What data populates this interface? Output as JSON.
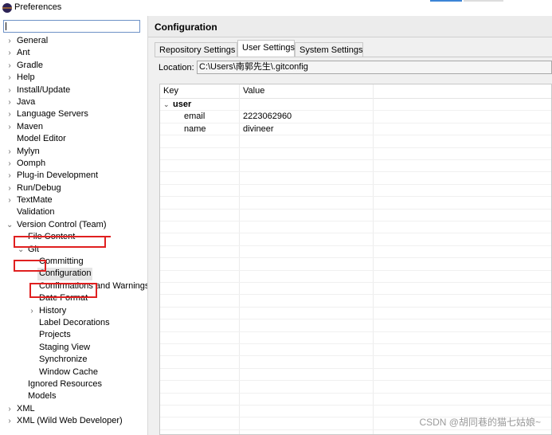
{
  "window": {
    "title": "Preferences"
  },
  "filter": {
    "value": ""
  },
  "tree": {
    "items": [
      {
        "label": "General",
        "expandable": true
      },
      {
        "label": "Ant",
        "expandable": true
      },
      {
        "label": "Gradle",
        "expandable": true
      },
      {
        "label": "Help",
        "expandable": true
      },
      {
        "label": "Install/Update",
        "expandable": true
      },
      {
        "label": "Java",
        "expandable": true
      },
      {
        "label": "Language Servers",
        "expandable": true
      },
      {
        "label": "Maven",
        "expandable": true
      },
      {
        "label": "Model Editor",
        "expandable": false
      },
      {
        "label": "Mylyn",
        "expandable": true
      },
      {
        "label": "Oomph",
        "expandable": true
      },
      {
        "label": "Plug-in Development",
        "expandable": true
      },
      {
        "label": "Run/Debug",
        "expandable": true
      },
      {
        "label": "TextMate",
        "expandable": true
      },
      {
        "label": "Validation",
        "expandable": false
      },
      {
        "label": "Version Control (Team)",
        "expandable": true,
        "expanded": true
      },
      {
        "label": "File Content",
        "expandable": false
      },
      {
        "label": "Git",
        "expandable": true,
        "expanded": true
      },
      {
        "label": "Committing",
        "expandable": false
      },
      {
        "label": "Configuration",
        "expandable": false,
        "selected": true
      },
      {
        "label": "Confirmations and Warnings",
        "expandable": false
      },
      {
        "label": "Date Format",
        "expandable": false
      },
      {
        "label": "History",
        "expandable": true
      },
      {
        "label": "Label Decorations",
        "expandable": false
      },
      {
        "label": "Projects",
        "expandable": false
      },
      {
        "label": "Staging View",
        "expandable": false
      },
      {
        "label": "Synchronize",
        "expandable": false
      },
      {
        "label": "Window Cache",
        "expandable": false
      },
      {
        "label": "Ignored Resources",
        "expandable": false
      },
      {
        "label": "Models",
        "expandable": false
      },
      {
        "label": "XML",
        "expandable": true
      },
      {
        "label": "XML (Wild Web Developer)",
        "expandable": true
      }
    ]
  },
  "page": {
    "title": "Configuration"
  },
  "tabs": [
    {
      "label": "Repository Settings",
      "active": false
    },
    {
      "label": "User Settings",
      "active": true
    },
    {
      "label": "System Settings",
      "active": false
    }
  ],
  "location": {
    "label": "Location:",
    "value": "C:\\Users\\南郭先生\\.gitconfig"
  },
  "table": {
    "headers": {
      "key": "Key",
      "value": "Value"
    },
    "rows": [
      {
        "key": "user",
        "value": "",
        "section": true
      },
      {
        "key": "email",
        "value": "2223062960",
        "section": false
      },
      {
        "key": "name",
        "value": "divineer",
        "section": false
      }
    ]
  },
  "watermark": "CSDN @胡同巷的猫七姑娘~",
  "colors": {
    "highlight": "#e02020",
    "selection": "#e5e5e5"
  },
  "icons": {
    "collapsed": "chevron-right-icon",
    "expanded": "chevron-down-icon"
  }
}
